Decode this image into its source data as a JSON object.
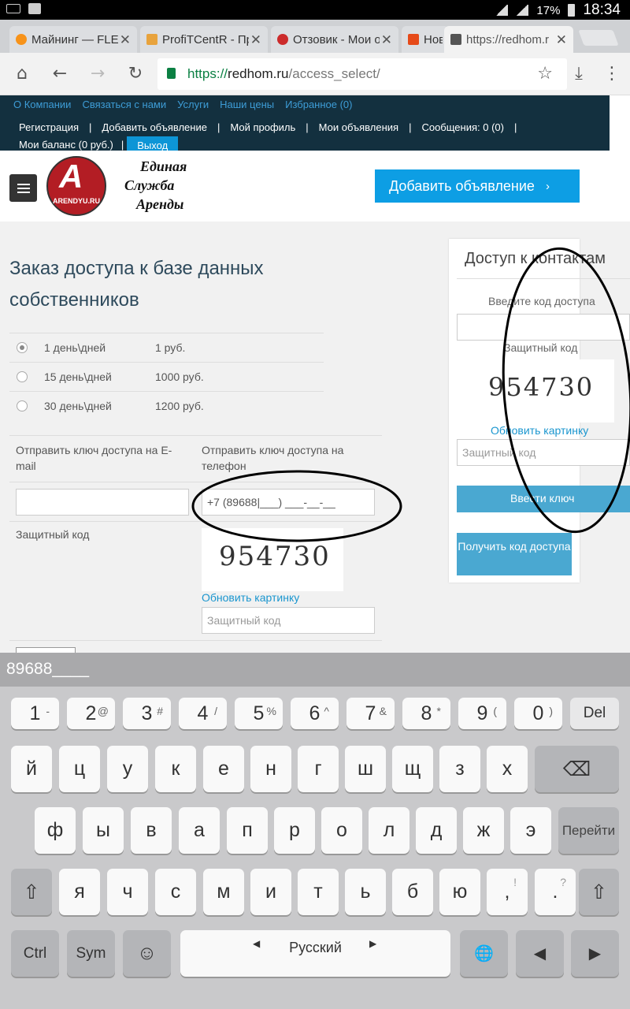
{
  "status_bar": {
    "battery": "17%",
    "time": "18:34"
  },
  "tabs": [
    {
      "label": "Майнинг — FLEE",
      "color": "#f7931a"
    },
    {
      "label": "ProfiTCentR - Пр",
      "color": "#e8a33d"
    },
    {
      "label": "Отзовик - Мои о",
      "color": "#cc2b2b"
    },
    {
      "label": "Нов",
      "color": "#e64a19"
    },
    {
      "label": "https://redhom.r",
      "color": "#555555"
    }
  ],
  "omnibox": {
    "scheme": "https://",
    "host": "redhom.ru",
    "path": "/access_select/"
  },
  "site_nav": {
    "top_links": [
      "О Компании",
      "Связаться с нами",
      "Услуги",
      "Наши цены",
      "Избранное (0)"
    ],
    "user_links": [
      "Регистрация",
      "Добавить объявление",
      "Мой профиль",
      "Мои объявления",
      "Сообщения: 0 (0)"
    ],
    "balance": "Мои баланс (0 руб.)",
    "logout": "Выход"
  },
  "header": {
    "logo_letter": "A",
    "logo_text": "ARENDYU.RU",
    "slogan": [
      "Единая",
      "Служба",
      "Аренды"
    ],
    "add_button": "Добавить объявление",
    "add_chevron": "›"
  },
  "main": {
    "title": "Заказ доступа к базе данных собственников",
    "plans": [
      {
        "duration": "1 день\\дней",
        "price": "1 руб.",
        "selected": true
      },
      {
        "duration": "15 день\\дней",
        "price": "1000 руб.",
        "selected": false
      },
      {
        "duration": "30 день\\дней",
        "price": "1200 руб.",
        "selected": false
      }
    ],
    "send_email_label": "Отправить ключ доступа на E-mail",
    "send_phone_label": "Отправить ключ доступа на телефон",
    "phone_value": "+7 (89688|___) ___-__-__",
    "captcha_label": "Защитный код",
    "captcha_code": "954730",
    "refresh": "Обновить картинку",
    "captcha_placeholder": "Защитный код"
  },
  "sidebar": {
    "title": "Доступ к контактам",
    "code_label": "Введите код доступа",
    "captcha_label": "Защитный код",
    "captcha_code": "954730",
    "refresh": "Обновить картинку",
    "captcha_placeholder": "Защитный код",
    "enter_button": "Ввести ключ",
    "get_code_button": "Получить код доступа"
  },
  "keyboard": {
    "composing": "89688____",
    "num_row": [
      {
        "k": "1",
        "s": "-"
      },
      {
        "k": "2",
        "s": "@"
      },
      {
        "k": "3",
        "s": "#"
      },
      {
        "k": "4",
        "s": "/"
      },
      {
        "k": "5",
        "s": "%"
      },
      {
        "k": "6",
        "s": "^"
      },
      {
        "k": "7",
        "s": "&"
      },
      {
        "k": "8",
        "s": "*"
      },
      {
        "k": "9",
        "s": "("
      },
      {
        "k": "0",
        "s": ")"
      }
    ],
    "del": "Del",
    "row1": [
      "й",
      "ц",
      "у",
      "к",
      "е",
      "н",
      "г",
      "ш",
      "щ",
      "з",
      "х"
    ],
    "backspace": "⌫",
    "row2": [
      "ф",
      "ы",
      "в",
      "а",
      "п",
      "р",
      "о",
      "л",
      "д",
      "ж",
      "э"
    ],
    "go": "Перейти",
    "row3": [
      "я",
      "ч",
      "с",
      "м",
      "и",
      "т",
      "ь",
      "б",
      "ю"
    ],
    "comma": ",",
    "comma_sub": "!",
    "period": ".",
    "period_sub": "?",
    "shift": "⇧",
    "ctrl": "Ctrl",
    "sym": "Sym",
    "emoji": "☺",
    "space": "Русский",
    "globe": "🌐",
    "left": "◀",
    "right": "▶"
  }
}
